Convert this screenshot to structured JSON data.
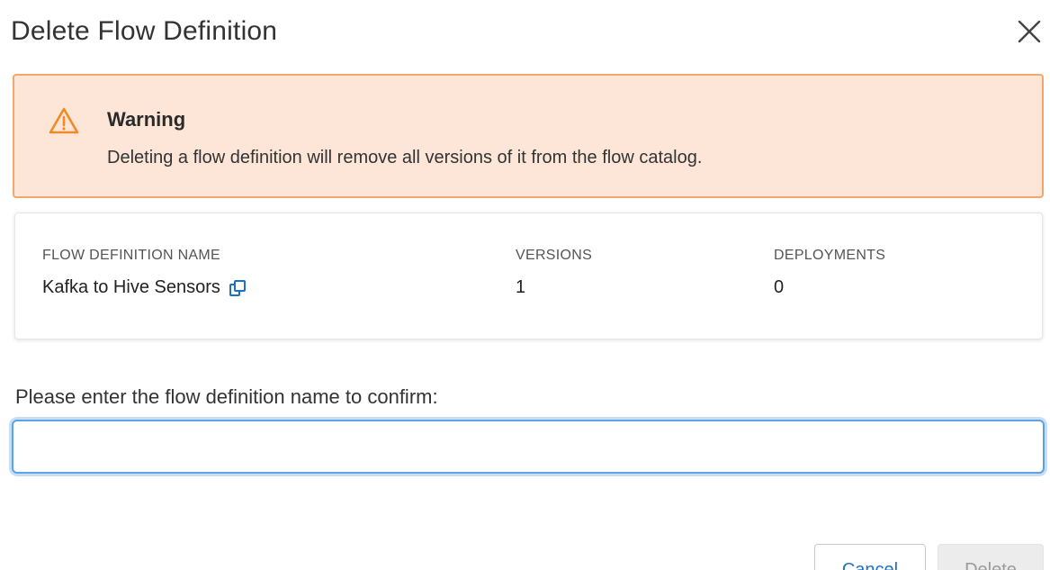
{
  "dialog": {
    "title": "Delete Flow Definition"
  },
  "warning": {
    "title": "Warning",
    "message": "Deleting a flow definition will remove all versions of it from the flow catalog."
  },
  "details": {
    "name_label": "FLOW DEFINITION NAME",
    "name_value": "Kafka to Hive Sensors",
    "versions_label": "VERSIONS",
    "versions_value": "1",
    "deployments_label": "DEPLOYMENTS",
    "deployments_value": "0"
  },
  "confirm": {
    "label": "Please enter the flow definition name to confirm:",
    "value": "",
    "placeholder": ""
  },
  "actions": {
    "cancel_label": "Cancel",
    "delete_label": "Delete"
  },
  "colors": {
    "warning_bg": "#fde6d8",
    "warning_border": "#f5a66b",
    "warning_icon": "#f08a24",
    "link_blue": "#1f6fc5",
    "focus_blue": "#5fa3e4",
    "disabled_bg": "#ececec"
  },
  "icons": {
    "close": "close-icon",
    "warning": "warning-icon",
    "copy": "copy-icon"
  }
}
